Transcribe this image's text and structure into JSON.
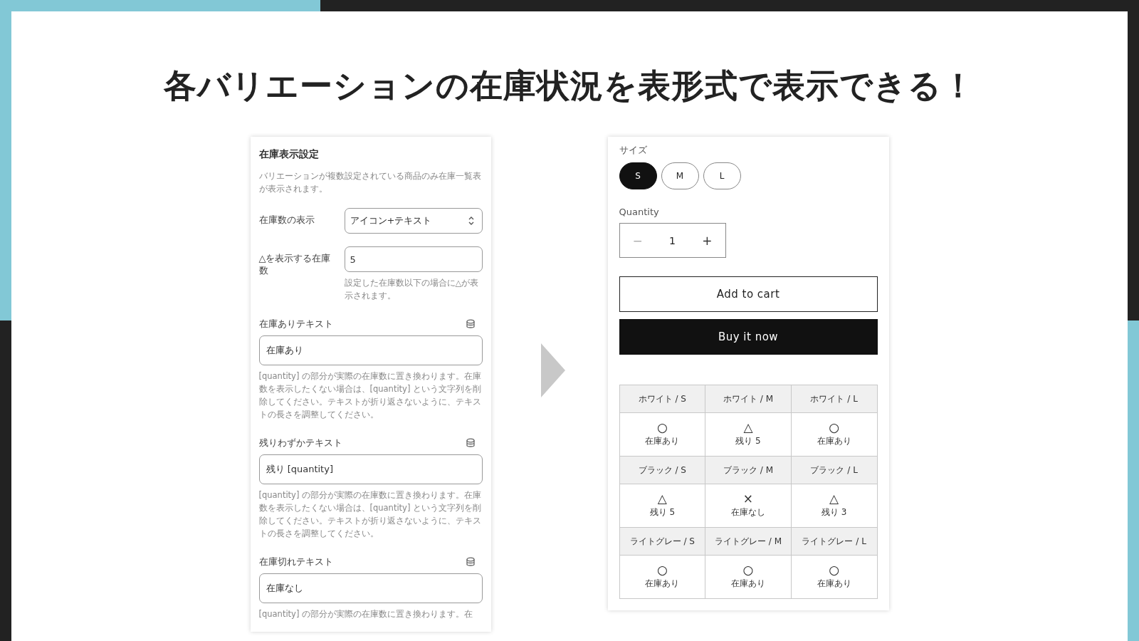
{
  "title": "各バリエーションの在庫状況を表形式で表示できる！",
  "settings": {
    "heading": "在庫表示設定",
    "description": "バリエーションが複数設定されている商品のみ在庫一覧表が表示されます。",
    "display_select": {
      "label": "在庫数の表示",
      "value": "アイコン+テキスト"
    },
    "threshold": {
      "label": "△を表示する在庫数",
      "value": "5",
      "help": "設定した在庫数以下の場合に△が表示されます。"
    },
    "text_fields": [
      {
        "label": "在庫ありテキスト",
        "value": "在庫あり",
        "help": "[quantity] の部分が実際の在庫数に置き換わります。在庫数を表示したくない場合は、[quantity] という文字列を削除してください。テキストが折り返さないように、テキストの長さを調整してください。"
      },
      {
        "label": "残りわずかテキスト",
        "value": "残り [quantity]",
        "help": "[quantity] の部分が実際の在庫数に置き換わります。在庫数を表示したくない場合は、[quantity] という文字列を削除してください。テキストが折り返さないように、テキストの長さを調整してください。"
      },
      {
        "label": "在庫切れテキスト",
        "value": "在庫なし",
        "help": "[quantity] の部分が実際の在庫数に置き換わります。在"
      }
    ]
  },
  "product": {
    "size_label": "サイズ",
    "sizes": [
      {
        "label": "S",
        "selected": true
      },
      {
        "label": "M",
        "selected": false
      },
      {
        "label": "L",
        "selected": false
      }
    ],
    "quantity_label": "Quantity",
    "quantity": {
      "decrement": "−",
      "value": "1",
      "increment": "+"
    },
    "buttons": [
      {
        "kind": "outline",
        "label": "Add to cart"
      },
      {
        "kind": "solid",
        "label": "Buy it now"
      }
    ],
    "stock_table": [
      [
        {
          "variant": "ホワイト / S",
          "symbol": "○",
          "status": "在庫あり"
        },
        {
          "variant": "ホワイト / M",
          "symbol": "△",
          "status": "残り 5"
        },
        {
          "variant": "ホワイト / L",
          "symbol": "○",
          "status": "在庫あり"
        }
      ],
      [
        {
          "variant": "ブラック / S",
          "symbol": "△",
          "status": "残り 5"
        },
        {
          "variant": "ブラック / M",
          "symbol": "×",
          "status": "在庫なし"
        },
        {
          "variant": "ブラック / L",
          "symbol": "△",
          "status": "残り 3"
        }
      ],
      [
        {
          "variant": "ライトグレー / S",
          "symbol": "○",
          "status": "在庫あり"
        },
        {
          "variant": "ライトグレー / M",
          "symbol": "○",
          "status": "在庫あり"
        },
        {
          "variant": "ライトグレー / L",
          "symbol": "○",
          "status": "在庫あり"
        }
      ]
    ]
  }
}
